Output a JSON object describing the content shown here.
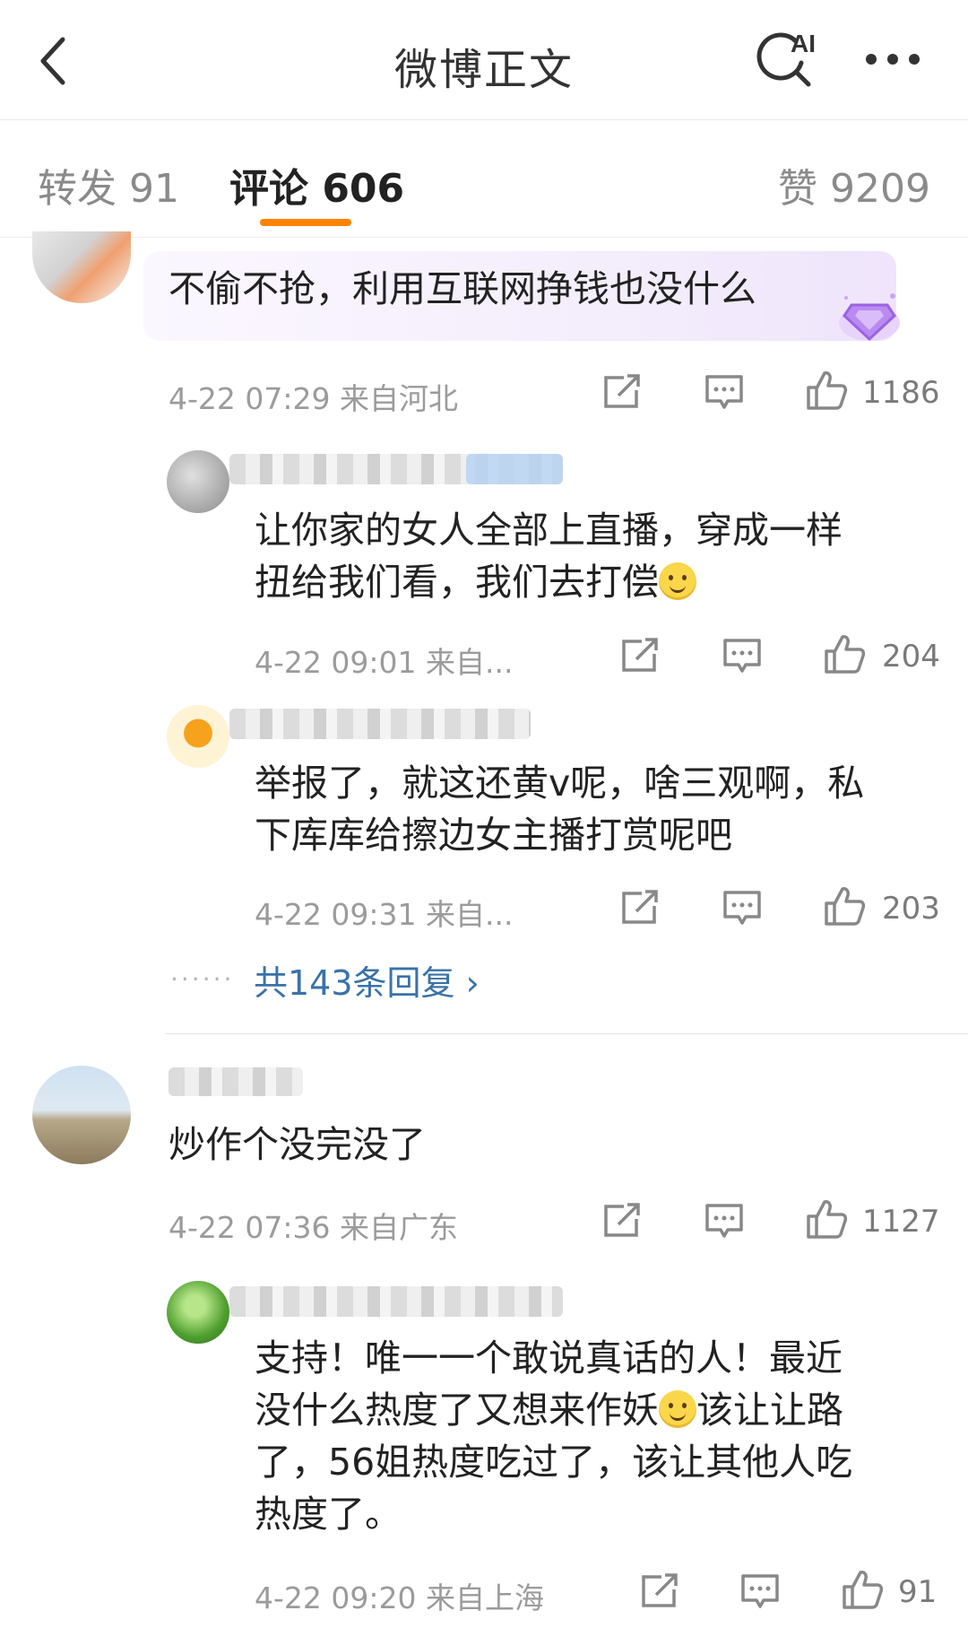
{
  "header": {
    "title": "微博正文",
    "ai_badge": "AI"
  },
  "tabs": [
    {
      "label": "转发 91"
    },
    {
      "label": "评论 606"
    },
    {
      "label": "赞 9209"
    }
  ],
  "colors": {
    "accent": "#ff8200",
    "link": "#3a72a8",
    "meta": "#9b9b9b"
  },
  "comments": [
    {
      "text": "不偷不抢，利用互联网挣钱也没什么",
      "meta": "4-22 07:29 来自河北",
      "likes": "1186",
      "replies": [
        {
          "text_lines": [
            "让你家的女人全部上直播，穿成一样",
            "扭给我们看，我们去打偿"
          ],
          "meta": "4-22 09:01 来自...",
          "likes": "204"
        },
        {
          "text_lines": [
            "举报了，就这还黄v呢，啥三观啊，私",
            "下库库给擦边女主播打赏呢吧"
          ],
          "meta": "4-22 09:31 来自...",
          "likes": "203"
        }
      ],
      "more_replies": "共143条回复 ›",
      "more_dots": "······"
    },
    {
      "text": "炒作个没完没了",
      "meta": "4-22 07:36 来自广东",
      "likes": "1127",
      "replies": [
        {
          "text_lines": [
            "支持！唯一一个敢说真话的人！最近",
            "没什么热度了又想来作妖",
            "该让让路",
            "了，56姐热度吃过了，该让其他人吃",
            "热度了。"
          ],
          "meta": "4-22 09:20 来自上海",
          "likes": "91"
        }
      ]
    }
  ],
  "icons": [
    "back-arrow-icon",
    "ai-search-icon",
    "more-icon",
    "share-icon",
    "comment-icon",
    "like-icon",
    "smile-emoji-icon",
    "diamond-badge-icon"
  ]
}
